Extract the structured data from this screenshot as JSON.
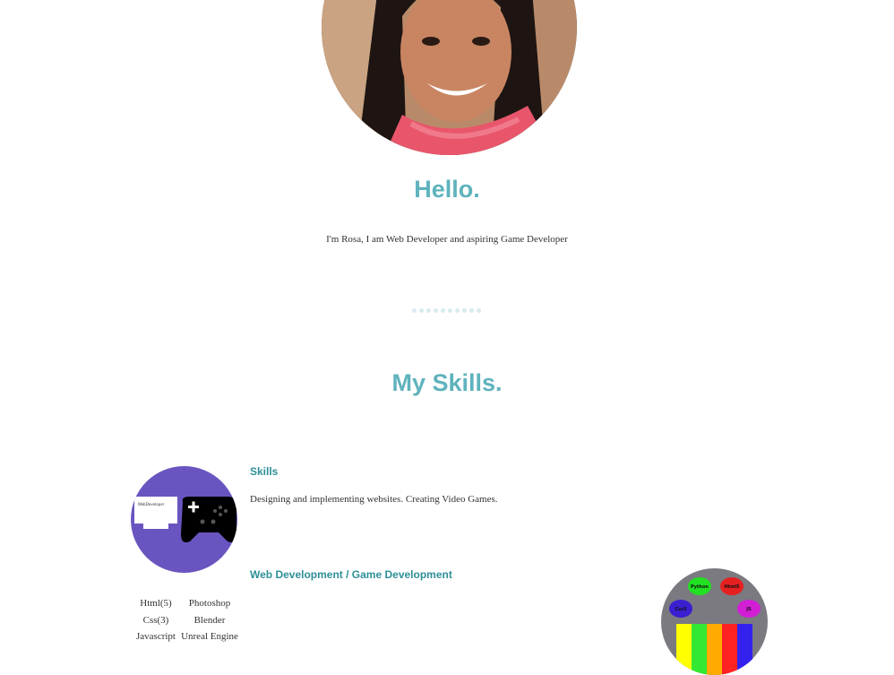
{
  "intro": {
    "heading": "Hello.",
    "text": "I'm Rosa, I am Web Developer and aspiring Game Developer"
  },
  "skills_section": {
    "heading": "My Skills.",
    "card": {
      "title": "Skills",
      "description": "Designing and implementing websites. Creating Video Games.",
      "subtitle": "Web Development / Game Development",
      "icon_caption": "WebDeveloper",
      "list_col_1": [
        "Html(5)",
        "Css(3)",
        "Javascript"
      ],
      "list_col_2": [
        "Photoshop",
        "Blender",
        "Unreal Engine"
      ]
    },
    "languages_icon": {
      "bubbles": [
        {
          "label": "Python",
          "color": "#22e022"
        },
        {
          "label": "Html5",
          "color": "#e52020"
        },
        {
          "label": "Css3",
          "color": "#3a1fd0"
        },
        {
          "label": "JS",
          "color": "#d21fd6"
        }
      ],
      "bars": [
        "#ffff00",
        "#33e833",
        "#ffaa00",
        "#ff2222",
        "#3322ee"
      ]
    }
  },
  "colors": {
    "accent": "#5fb3bd",
    "link": "#2e8f97",
    "skills_icon_bg": "#6a55c0"
  }
}
